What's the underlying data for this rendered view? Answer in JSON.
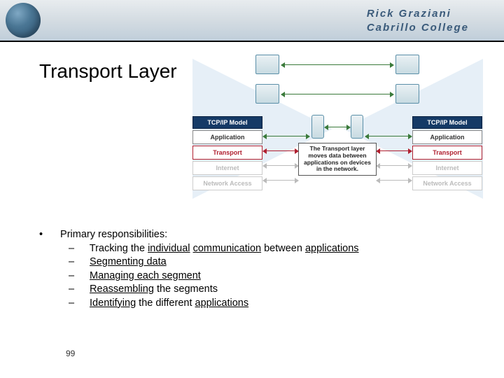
{
  "header": {
    "line1": "Rick Graziani",
    "line2": "Cabrillo College"
  },
  "title": "Transport Layer",
  "diagram": {
    "stack_header": "TCP/IP Model",
    "layers": {
      "application": "Application",
      "transport": "Transport",
      "internet": "Internet",
      "network_access": "Network Access"
    },
    "caption": "The Transport layer moves data between applications on devices in the network."
  },
  "content": {
    "intro": "Primary responsibilities:",
    "items": [
      {
        "pre": "Tracking the ",
        "u1": "individual",
        "mid": " ",
        "u2": "communication",
        "post": " between ",
        "u3": "applications"
      },
      {
        "u1": "Segmenting data"
      },
      {
        "u1": "Managing each segment"
      },
      {
        "u1": "Reassembling",
        "post": " the segments"
      },
      {
        "u1": "Identifying",
        "post": " the different ",
        "u2": "applications"
      }
    ]
  },
  "slide_number": "99"
}
